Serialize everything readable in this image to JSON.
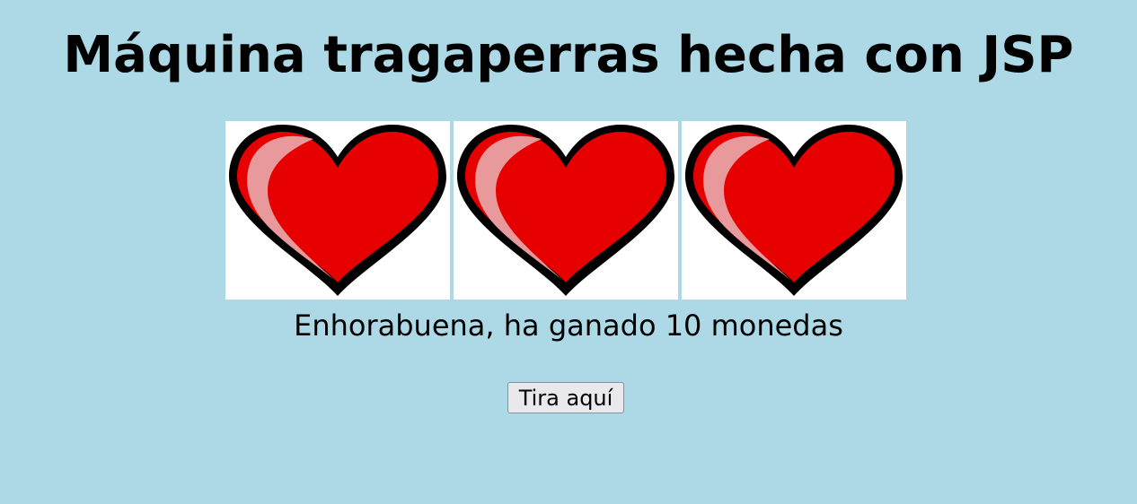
{
  "page": {
    "title": "Máquina tragaperras hecha con JSP",
    "background_color": "#add8e6"
  },
  "reels": [
    {
      "symbol": "heart-icon"
    },
    {
      "symbol": "heart-icon"
    },
    {
      "symbol": "heart-icon"
    }
  ],
  "result": {
    "message": "Enhorabuena, ha ganado 10 monedas"
  },
  "controls": {
    "spin_label": "Tira aquí"
  },
  "colors": {
    "heart_fill": "#e60000",
    "heart_outline": "#000000",
    "heart_highlight": "#e8999b",
    "reel_background": "#ffffff"
  }
}
